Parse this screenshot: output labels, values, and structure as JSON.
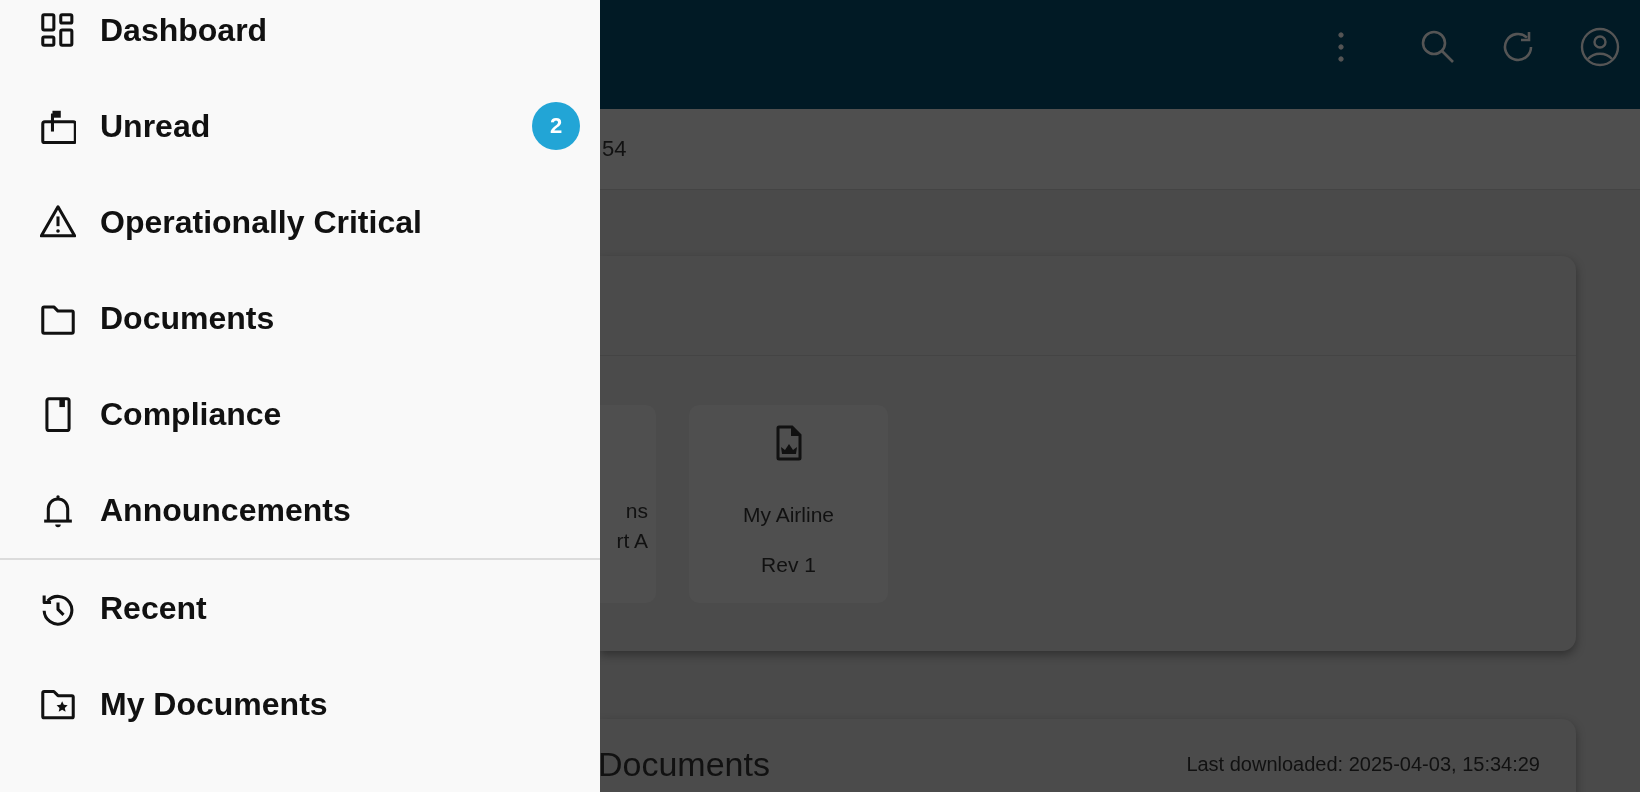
{
  "drawer": {
    "sections": [
      {
        "items": [
          {
            "label": "Dashboard"
          },
          {
            "label": "Unread",
            "badge": "2"
          },
          {
            "label": "Operationally Critical"
          },
          {
            "label": "Documents"
          },
          {
            "label": "Compliance"
          },
          {
            "label": "Announcements"
          }
        ]
      },
      {
        "items": [
          {
            "label": "Recent"
          },
          {
            "label": "My Documents"
          }
        ]
      }
    ]
  },
  "main": {
    "subheader": "54",
    "library_card": {
      "tiles": [
        {
          "lines": [
            "ns",
            "rt A"
          ]
        },
        {
          "lines": [
            "My Airline",
            "Rev 1"
          ]
        }
      ]
    },
    "documents_card": {
      "title": "Documents",
      "last_downloaded": "Last downloaded: 2025-04-03, 15:34:29"
    }
  }
}
